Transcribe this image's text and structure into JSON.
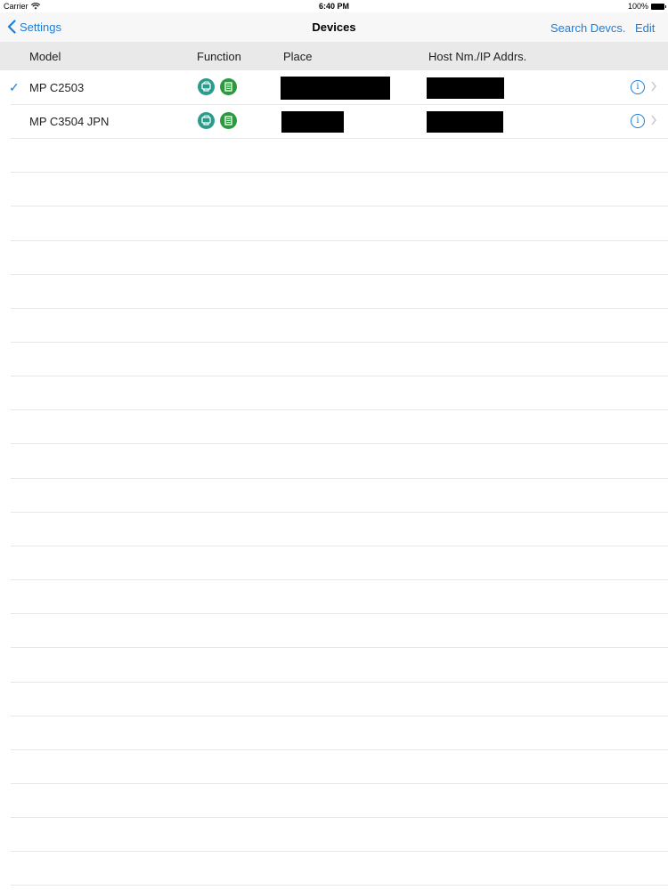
{
  "status_bar": {
    "carrier": "Carrier",
    "time": "6:40 PM",
    "battery": "100%"
  },
  "nav": {
    "back_label": "Settings",
    "title": "Devices",
    "search_label": "Search Devcs.",
    "edit_label": "Edit"
  },
  "columns": {
    "model": "Model",
    "function": "Function",
    "place": "Place",
    "host": "Host Nm./IP Addrs."
  },
  "devices": [
    {
      "model": "MP C2503",
      "selected": true
    },
    {
      "model": "MP C3504 JPN",
      "selected": false
    }
  ],
  "colors": {
    "accent": "#1a7ee0",
    "copy_icon": "#2a9c8c",
    "print_icon": "#2a9a3d",
    "header_bg": "#e9e9e9"
  },
  "icons": [
    "chevron-left-icon",
    "check-icon",
    "copy-function-icon",
    "print-function-icon",
    "info-icon",
    "chevron-right-icon",
    "wifi-icon",
    "battery-icon"
  ]
}
